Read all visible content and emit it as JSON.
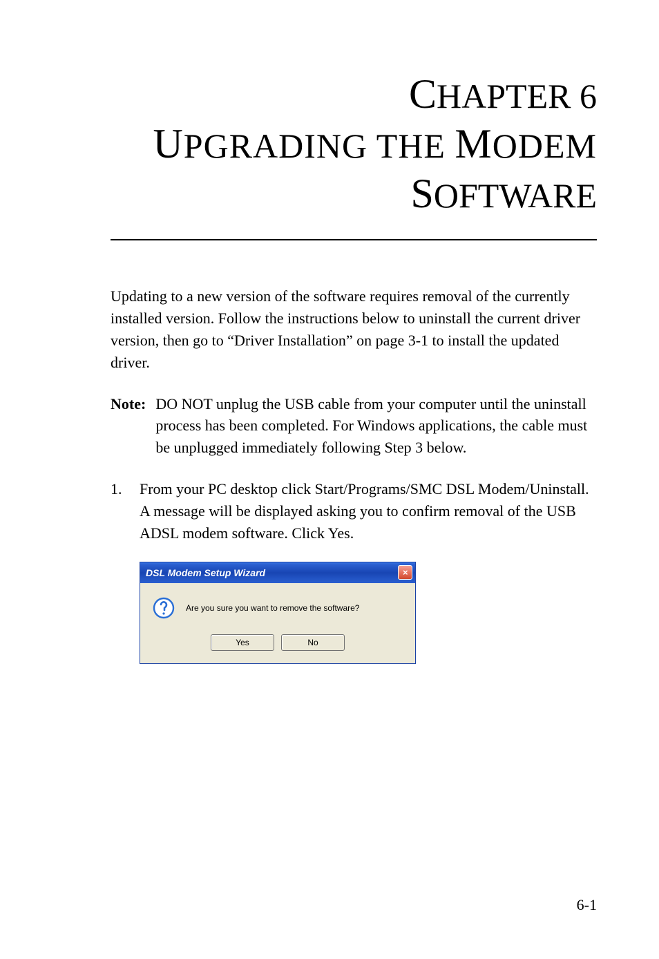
{
  "chapter": {
    "line1_pre": "C",
    "line1_rest": "HAPTER",
    "line1_num": " 6",
    "line2_cap1": "U",
    "line2_rest1": "PGRADING THE ",
    "line2_cap2": "M",
    "line2_rest2": "ODEM",
    "line3_cap": "S",
    "line3_rest": "OFTWARE"
  },
  "intro": "Updating to a new version of the software requires removal of the currently installed version. Follow the instructions below to uninstall the current driver version, then go to “Driver Installation” on page 3-1 to install the updated driver.",
  "note": {
    "label": "Note:",
    "text": "DO NOT unplug the USB cable from your computer until the uninstall process has been completed. For Windows applications, the cable must be unplugged immediately following Step 3 below."
  },
  "step1": {
    "num": "1.",
    "text": "From your PC desktop click Start/Programs/SMC DSL Modem/Uninstall. A message will be displayed asking you to confirm removal of the USB ADSL modem software. Click Yes."
  },
  "dialog": {
    "title": "DSL Modem Setup Wizard",
    "close_glyph": "×",
    "message": "Are you sure you want to remove the software?",
    "yes": "Yes",
    "no": "No"
  },
  "page_number": "6-1"
}
